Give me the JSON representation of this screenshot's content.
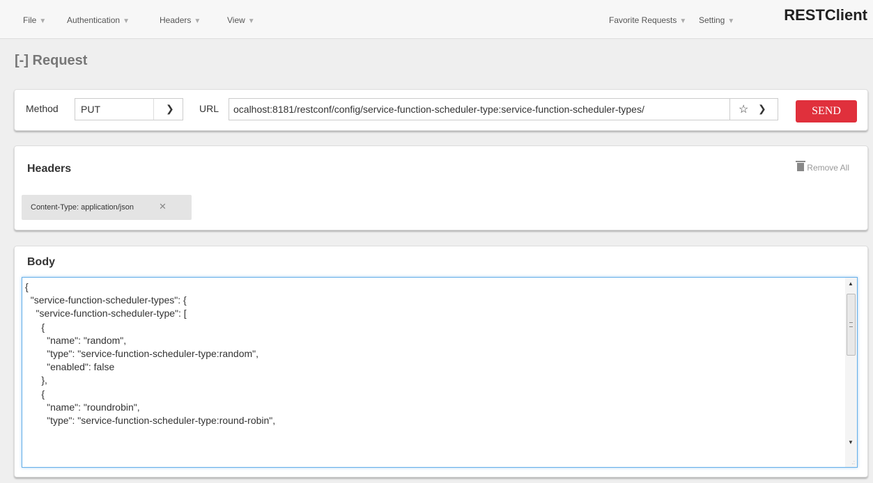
{
  "menu": {
    "left": [
      {
        "label": "File"
      },
      {
        "label": "Authentication"
      },
      {
        "label": "Headers"
      },
      {
        "label": "View"
      }
    ],
    "right": [
      {
        "label": "Favorite Requests"
      },
      {
        "label": "Setting"
      }
    ],
    "brand": "RESTClient"
  },
  "request": {
    "title": "[-] Request",
    "method_label": "Method",
    "method_value": "PUT",
    "url_label": "URL",
    "url_value": "ocalhost:8181/restconf/config/service-function-scheduler-type:service-function-scheduler-types/",
    "send_label": "SEND"
  },
  "headers": {
    "title": "Headers",
    "remove_all_label": "Remove All",
    "items": [
      {
        "text": "Content-Type: application/json"
      }
    ]
  },
  "body": {
    "title": "Body",
    "content": "{\n  \"service-function-scheduler-types\": {\n    \"service-function-scheduler-type\": [\n      {\n        \"name\": \"random\",\n        \"type\": \"service-function-scheduler-type:random\",\n        \"enabled\": false\n      },\n      {\n        \"name\": \"roundrobin\",\n        \"type\": \"service-function-scheduler-type:round-robin\","
  },
  "colors": {
    "send_button": "#e0303c",
    "editor_focus_border": "#66afe9"
  },
  "icons": [
    "caret-down-icon",
    "chevron-down-icon",
    "star-icon",
    "trash-icon",
    "close-icon"
  ]
}
